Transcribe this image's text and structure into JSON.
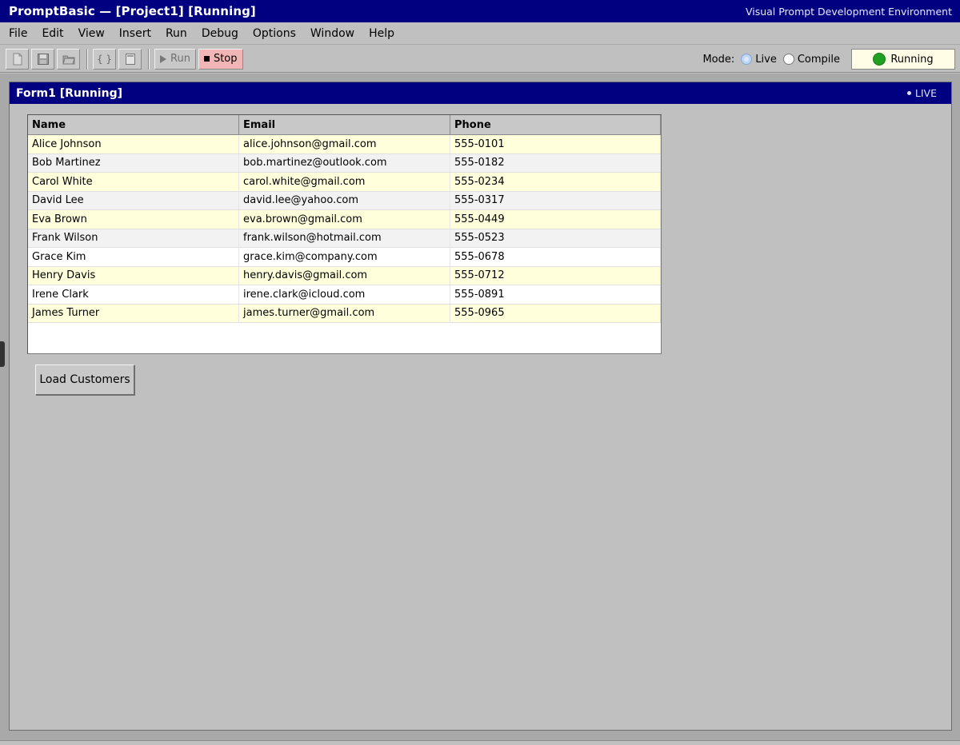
{
  "window": {
    "title": "PromptBasic — [Project1] [Running]",
    "subtitle": "Visual Prompt Development Environment"
  },
  "menu": [
    "File",
    "Edit",
    "View",
    "Insert",
    "Run",
    "Debug",
    "Options",
    "Window",
    "Help"
  ],
  "toolbar": {
    "code_glyph": "{ }",
    "run_label": "Run",
    "stop_label": "Stop",
    "mode_label": "Mode:",
    "mode_options": [
      {
        "label": "Live",
        "selected": true
      },
      {
        "label": "Compile",
        "selected": false
      }
    ],
    "status_label": "Running",
    "status_color": "#22a022"
  },
  "form": {
    "title": "Form1 [Running]",
    "live_label": "LIVE",
    "grid": {
      "columns": [
        "Name",
        "Email",
        "Phone"
      ],
      "rows": [
        {
          "name": "Alice Johnson",
          "email": "alice.johnson@gmail.com",
          "phone": "555-0101",
          "style": "yellow"
        },
        {
          "name": "Bob Martinez",
          "email": "bob.martinez@outlook.com",
          "phone": "555-0182",
          "style": "gray"
        },
        {
          "name": "Carol White",
          "email": "carol.white@gmail.com",
          "phone": "555-0234",
          "style": "yellow"
        },
        {
          "name": "David Lee",
          "email": "david.lee@yahoo.com",
          "phone": "555-0317",
          "style": "gray"
        },
        {
          "name": "Eva Brown",
          "email": "eva.brown@gmail.com",
          "phone": "555-0449",
          "style": "yellow"
        },
        {
          "name": "Frank Wilson",
          "email": "frank.wilson@hotmail.com",
          "phone": "555-0523",
          "style": "gray"
        },
        {
          "name": "Grace Kim",
          "email": "grace.kim@company.com",
          "phone": "555-0678",
          "style": "white"
        },
        {
          "name": "Henry Davis",
          "email": "henry.davis@gmail.com",
          "phone": "555-0712",
          "style": "yellow"
        },
        {
          "name": "Irene Clark",
          "email": "irene.clark@icloud.com",
          "phone": "555-0891",
          "style": "white"
        },
        {
          "name": "James Turner",
          "email": "james.turner@gmail.com",
          "phone": "555-0965",
          "style": "yellow"
        }
      ]
    },
    "load_button_label": "Load Customers"
  }
}
